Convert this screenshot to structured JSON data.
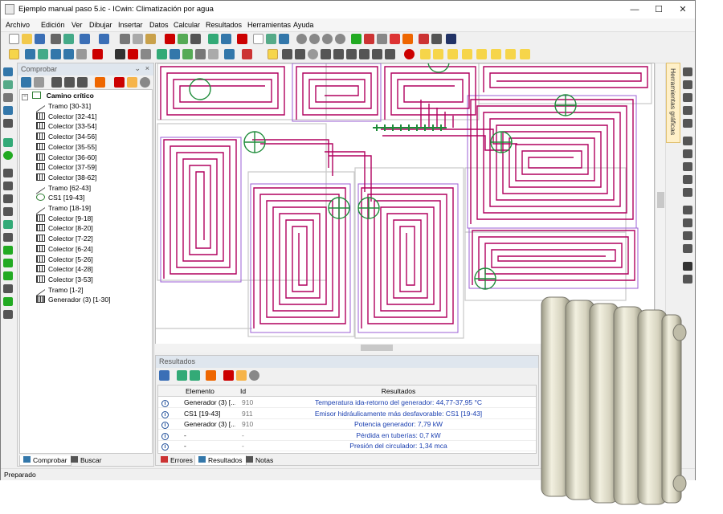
{
  "window": {
    "title": "Ejemplo manual paso 5.ic - ICwin: Climatización por agua"
  },
  "menu": [
    "Archivo",
    "Edición",
    "Ver",
    "Dibujar",
    "Insertar",
    "Datos",
    "Calcular",
    "Resultados",
    "Herramientas",
    "Ayuda"
  ],
  "left_panel": {
    "title": "Comprobar",
    "tree_root": "Camino crítico",
    "tree_items": [
      {
        "label": "Tramo [30-31]",
        "icon": "tramo-icon"
      },
      {
        "label": "Colector [32-41]",
        "icon": "collector-icon"
      },
      {
        "label": "Colector [33-54]",
        "icon": "collector-icon"
      },
      {
        "label": "Colector [34-56]",
        "icon": "collector-icon"
      },
      {
        "label": "Colector [35-55]",
        "icon": "collector-icon"
      },
      {
        "label": "Colector [36-60]",
        "icon": "collector-icon"
      },
      {
        "label": "Colector [37-59]",
        "icon": "collector-icon"
      },
      {
        "label": "Colector [38-62]",
        "icon": "collector-icon"
      },
      {
        "label": "Tramo [62-43]",
        "icon": "tramo-icon"
      },
      {
        "label": "CS1 [19-43]",
        "icon": "circulator-icon"
      },
      {
        "label": "Tramo [18-19]",
        "icon": "tramo-icon"
      },
      {
        "label": "Colector [9-18]",
        "icon": "collector-icon"
      },
      {
        "label": "Colector [8-20]",
        "icon": "collector-icon"
      },
      {
        "label": "Colector [7-22]",
        "icon": "collector-icon"
      },
      {
        "label": "Colector [6-24]",
        "icon": "collector-icon"
      },
      {
        "label": "Colector [5-26]",
        "icon": "collector-icon"
      },
      {
        "label": "Colector [4-28]",
        "icon": "collector-icon"
      },
      {
        "label": "Colector [3-53]",
        "icon": "collector-icon"
      },
      {
        "label": "Tramo [1-2]",
        "icon": "tramo-icon"
      },
      {
        "label": "Generador (3) [1-30]",
        "icon": "generator-icon"
      }
    ],
    "tabs": [
      "Comprobar",
      "Buscar"
    ]
  },
  "right_dock": {
    "label": "Herramientas gráficas"
  },
  "results": {
    "title": "Resultados",
    "columns": [
      "Elemento",
      "Id",
      "Resultados"
    ],
    "rows": [
      {
        "element": "Generador (3) [...",
        "id": "910",
        "result": "Temperatura ida-retorno del generador: 44,77-37,95 °C"
      },
      {
        "element": "CS1 [19-43]",
        "id": "911",
        "result": "Emisor hidráulicamente más desfavorable: CS1 [19-43]"
      },
      {
        "element": "Generador (3) [...",
        "id": "910",
        "result": "Potencia generador: 7,79 kW"
      },
      {
        "element": "-",
        "id": "-",
        "result": "Pérdida en tuberías: 0,7 kW"
      },
      {
        "element": "-",
        "id": "-",
        "result": "Presión del circulador: 1,34 mca"
      }
    ],
    "tabs": [
      "Errores",
      "Resultados",
      "Notas"
    ]
  },
  "status": {
    "text": "Preparado"
  },
  "colors": {
    "pipe": "#b0005e",
    "circulator": "#1e8c3a",
    "link": "#1a3fb0",
    "wall": "#c8c8c8"
  }
}
